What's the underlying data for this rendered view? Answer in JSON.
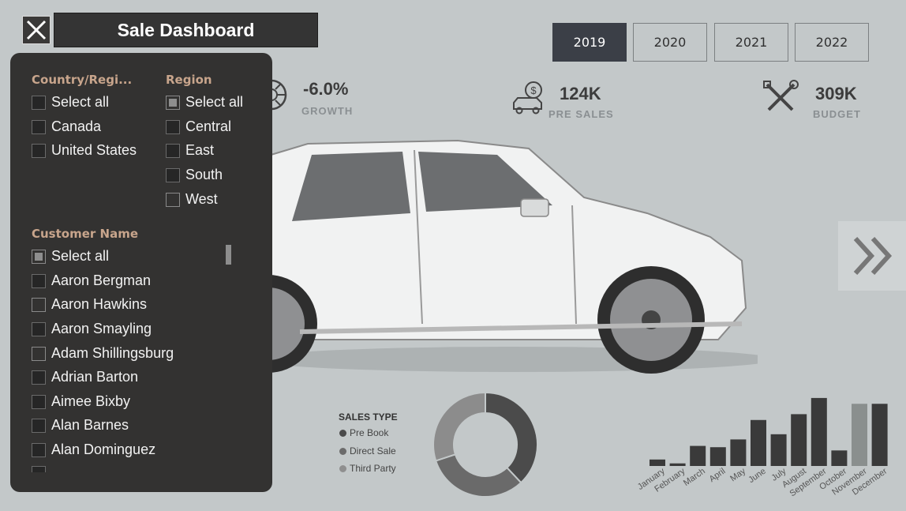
{
  "header": {
    "close_icon": "close-icon",
    "title": "Sale Dashboard",
    "years": [
      "2019",
      "2020",
      "2021",
      "2022"
    ],
    "active_year": "2019"
  },
  "kpis": [
    {
      "value": "-6.0%",
      "label": "GROWTH",
      "icon": "wheel-icon"
    },
    {
      "value": "124K",
      "label": "PRE SALES",
      "icon": "car-dollar-icon"
    },
    {
      "value": "309K",
      "label": "BUDGET",
      "icon": "tools-icon"
    }
  ],
  "filters": {
    "country": {
      "title": "Country/Regi...",
      "options": [
        "Select all",
        "Canada",
        "United States"
      ]
    },
    "region": {
      "title": "Region",
      "options": [
        "Select all",
        "Central",
        "East",
        "South",
        "West"
      ]
    },
    "customer": {
      "title": "Customer Name",
      "options": [
        "Select all",
        "Aaron Bergman",
        "Aaron Hawkins",
        "Aaron Smayling",
        "Adam Shillingsburg",
        "Adrian Barton",
        "Aimee Bixby",
        "Alan Barnes",
        "Alan Dominguez"
      ]
    }
  },
  "sales_type": {
    "title": "SALES TYPE",
    "items": [
      {
        "label": "Pre Book",
        "color": "#4a4a4a"
      },
      {
        "label": "Direct Sale",
        "color": "#6b6b6b"
      },
      {
        "label": "Third Party",
        "color": "#8f8f8f"
      }
    ]
  },
  "nav": {
    "next_icon": "double-chevron-right-icon"
  },
  "chart_data": [
    {
      "type": "pie",
      "categories": [
        "Pre Book",
        "Direct Sale",
        "Third Party"
      ],
      "values": [
        38,
        32,
        30
      ],
      "colors": [
        "#4b4b4b",
        "#6a6a6a",
        "#8c8c8c"
      ]
    },
    {
      "type": "bar",
      "categories": [
        "January",
        "February",
        "March",
        "April",
        "May",
        "June",
        "July",
        "August",
        "September",
        "October",
        "November",
        "December"
      ],
      "values": [
        10,
        4,
        31,
        29,
        41,
        71,
        49,
        80,
        105,
        24,
        96,
        96
      ],
      "colors": [
        "#3a3a3a",
        "#3a3a3a",
        "#3a3a3a",
        "#3a3a3a",
        "#3a3a3a",
        "#3a3a3a",
        "#3a3a3a",
        "#3a3a3a",
        "#3a3a3a",
        "#3a3a3a",
        "#8a8f8e",
        "#3a3a3a"
      ]
    }
  ]
}
